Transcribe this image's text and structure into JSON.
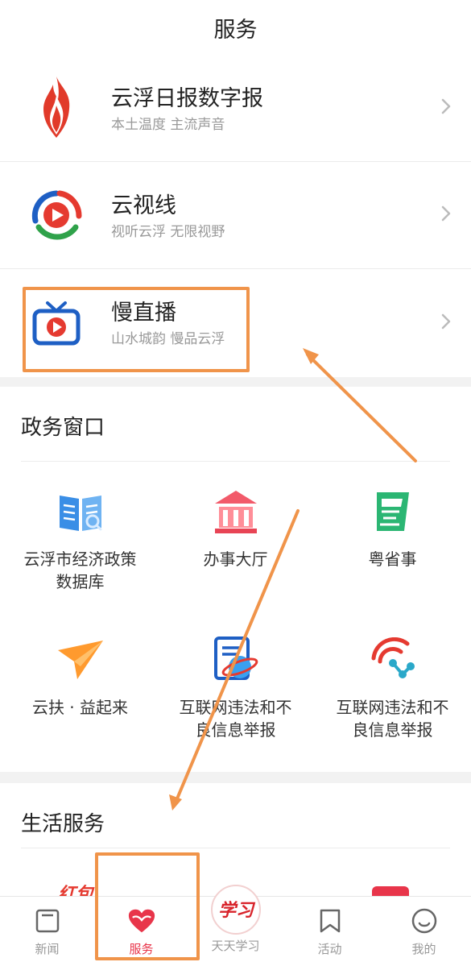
{
  "header": {
    "title": "服务"
  },
  "apps": [
    {
      "title": "云浮日报数字报",
      "subtitle": "本土温度  主流声音",
      "icon": "flame-logo-icon"
    },
    {
      "title": "云视线",
      "subtitle": "视听云浮  无限视野",
      "icon": "cloud-video-logo-icon"
    },
    {
      "title": "慢直播",
      "subtitle": "山水城韵  慢品云浮",
      "icon": "tv-play-icon"
    }
  ],
  "government": {
    "title": "政务窗口",
    "items": [
      {
        "label": "云浮市经济政策\n数据库",
        "icon": "book-search-icon"
      },
      {
        "label": "办事大厅",
        "icon": "government-building-icon"
      },
      {
        "label": "粤省事",
        "icon": "yue-app-icon"
      },
      {
        "label": "云扶 · 益起来",
        "icon": "paper-plane-icon"
      },
      {
        "label": "互联网违法和不\n良信息举报",
        "icon": "document-globe-icon"
      },
      {
        "label": "互联网违法和不\n良信息举报",
        "icon": "network-signal-icon"
      }
    ]
  },
  "life": {
    "title": "生活服务",
    "peek_text": "红包"
  },
  "tabbar": {
    "items": [
      {
        "label": "新闻",
        "icon": "news-icon",
        "active": false
      },
      {
        "label": "服务",
        "icon": "heart-service-icon",
        "active": true
      },
      {
        "label": "天天学习",
        "icon": "xuexi-logo-icon",
        "active": false
      },
      {
        "label": "活动",
        "icon": "bookmark-activity-icon",
        "active": false
      },
      {
        "label": "我的",
        "icon": "profile-icon",
        "active": false
      }
    ]
  },
  "colors": {
    "accent_red": "#e8354a",
    "annotation_orange": "#f0944a"
  }
}
